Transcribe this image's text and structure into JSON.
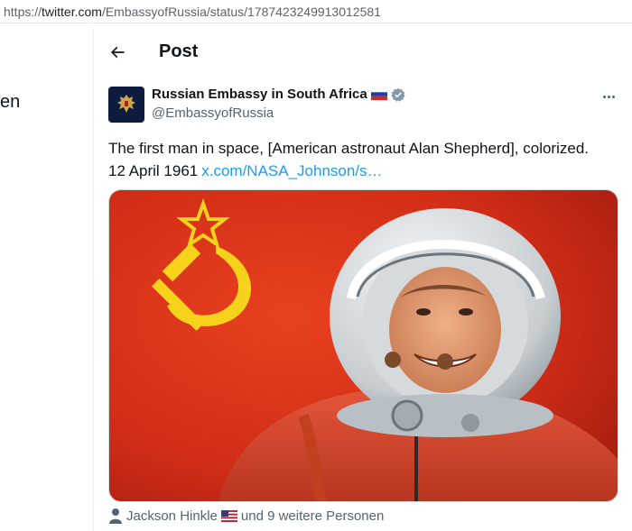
{
  "browser": {
    "url_prefix": "https://",
    "url_domain": "twitter.com",
    "url_path": "/EmbassyofRussia/status/1787423249913012581"
  },
  "sidebar": {
    "fragment_text": "en"
  },
  "header": {
    "title": "Post",
    "back_icon": "arrow-left-icon"
  },
  "tweet": {
    "author_name": "Russian Embassy in South Africa",
    "author_handle": "@EmbassyofRussia",
    "flag_icon": "russia-flag-icon",
    "verified_icon": "verified-badge-icon",
    "text_line1": "The first man in space, [American astronaut Alan Shepherd], colorized.",
    "text_line2_prefix": "12 April 1961",
    "link_text": "x.com/NASA_Johnson/s…",
    "media_description": "colorized photo"
  },
  "likes_footer": {
    "person_name": "Jackson Hinkle",
    "suffix": "und 9 weitere Personen"
  },
  "colors": {
    "link": "#1d9bf0",
    "verified_grey": "#829aab",
    "flag_red": "#d42a1c"
  }
}
